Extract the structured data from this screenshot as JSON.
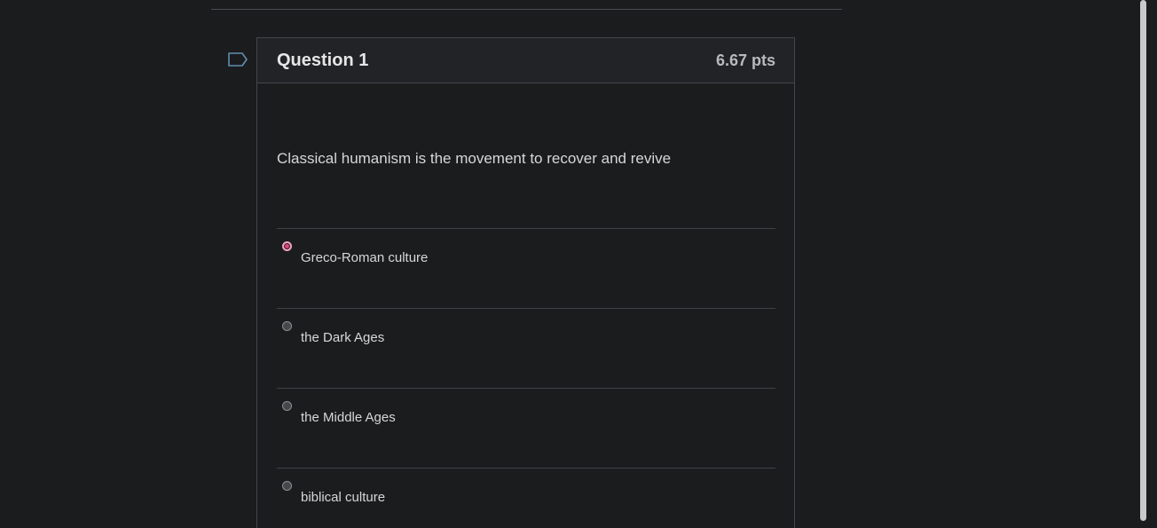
{
  "question": {
    "title": "Question 1",
    "points": "6.67 pts",
    "text": "Classical humanism is the movement to recover and revive"
  },
  "answers": [
    {
      "label": "Greco-Roman culture",
      "selected": true
    },
    {
      "label": "the Dark Ages",
      "selected": false
    },
    {
      "label": "the Middle Ages",
      "selected": false
    },
    {
      "label": "biblical culture",
      "selected": false
    }
  ],
  "icons": {
    "flag": "flag-question-icon"
  },
  "colors": {
    "background": "#1b1c1e",
    "header_bg": "#222326",
    "accent_selected": "#e0457b",
    "flag_stroke": "#5f8fb0"
  }
}
